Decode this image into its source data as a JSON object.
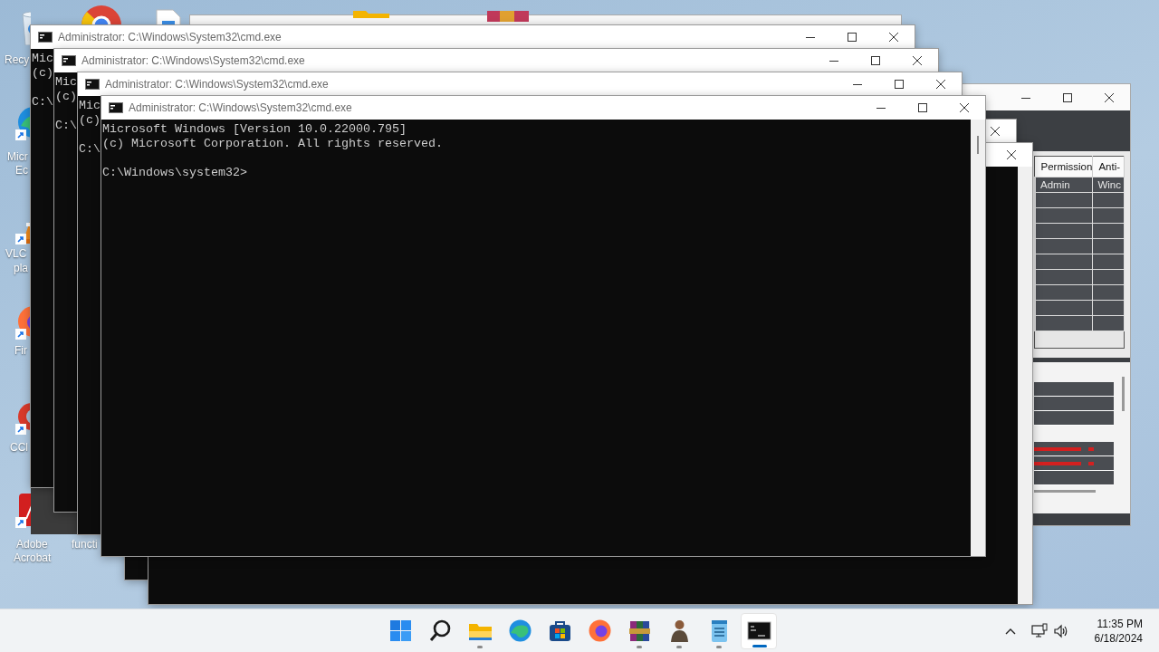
{
  "desktop_icons": [
    {
      "kind": "recycle-bin",
      "label_lines": [
        "Recy"
      ]
    },
    {
      "kind": "edge",
      "label_lines": [
        "Micr",
        "Ec"
      ]
    },
    {
      "kind": "vlc",
      "label_lines": [
        "VLC",
        "pla"
      ]
    },
    {
      "kind": "firefox",
      "label_lines": [
        "Fir"
      ]
    },
    {
      "kind": "ccleaner",
      "label_lines": [
        "CCl"
      ]
    },
    {
      "kind": "acrobat",
      "label_lines": [
        "Adobe",
        "Acrobat"
      ]
    },
    {
      "kind": "covered",
      "label_lines": [
        "functi"
      ]
    }
  ],
  "permission_window": {
    "columns": [
      "Permission",
      "Anti-"
    ],
    "rows": [
      [
        "Admin",
        "Winc"
      ]
    ]
  },
  "console_windows": [
    {
      "kind": "covered"
    },
    {
      "kind": "covered"
    },
    {
      "kind": "open",
      "title": "Administrator: C:\\Windows\\System32\\cmd.exe",
      "output": [
        "Mic",
        "(c)"
      ],
      "prompt": "C:\\"
    },
    {
      "kind": "open",
      "title": "Administrator: C:\\Windows\\System32\\cmd.exe",
      "output": [
        "Mic",
        "(c)"
      ],
      "prompt": "C:\\"
    },
    {
      "kind": "open",
      "title": "Administrator: C:\\Windows\\System32\\cmd.exe",
      "output": [
        "Mic",
        "(c)"
      ],
      "prompt": "C:\\"
    },
    {
      "kind": "open",
      "title": "Administrator: C:\\Windows\\System32\\cmd.exe",
      "output": [
        "Microsoft Windows [Version 10.0.22000.795]",
        "(c) Microsoft Corporation. All rights reserved."
      ],
      "prompt": "C:\\Windows\\system32>"
    }
  ],
  "taskbar": {
    "apps": [
      {
        "kind": "start",
        "running": false,
        "selected": false
      },
      {
        "kind": "search",
        "running": false,
        "selected": false
      },
      {
        "kind": "explorer",
        "running": true,
        "selected": false
      },
      {
        "kind": "edge",
        "running": false,
        "selected": false
      },
      {
        "kind": "store",
        "running": false,
        "selected": false
      },
      {
        "kind": "firefox",
        "running": false,
        "selected": false
      },
      {
        "kind": "winrar",
        "running": true,
        "selected": false
      },
      {
        "kind": "figure",
        "running": true,
        "selected": false
      },
      {
        "kind": "notepad",
        "running": true,
        "selected": false
      },
      {
        "kind": "terminal",
        "running": true,
        "selected": true
      }
    ],
    "clock": {
      "time": "11:35 PM",
      "date": "6/18/2024"
    }
  }
}
